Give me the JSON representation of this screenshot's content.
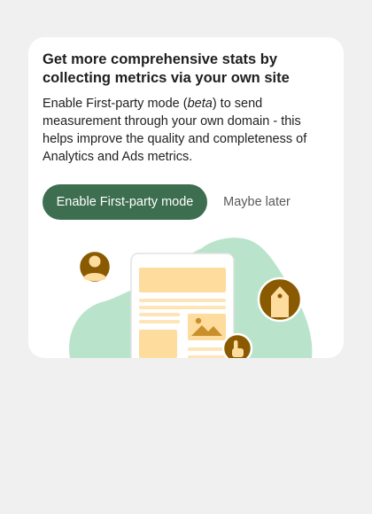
{
  "card": {
    "title": "Get more comprehensive stats by collecting metrics via your own site",
    "description": {
      "before": "Enable First-party mode (",
      "emphasis": "beta",
      "after": ") to send measurement through your own domain - this helps improve the quality and completeness of Analytics and Ads metrics."
    },
    "primary_button": "Enable First-party mode",
    "secondary_button": "Maybe later"
  },
  "colors": {
    "page_background": "#f0f0f0",
    "card_background": "#ffffff",
    "primary_button": "#3d6e4f",
    "blob": "#b9e4cb",
    "accent_brown": "#8a5a00",
    "accent_light": "#fddc9e"
  },
  "illustration": {
    "icons": [
      "user-avatar-icon",
      "webpage-document-icon",
      "image-icon",
      "pointer-hand-icon",
      "domain-tag-icon"
    ]
  }
}
